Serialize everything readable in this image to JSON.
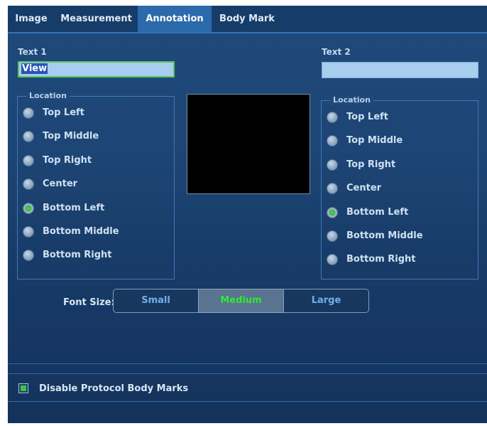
{
  "tabs": [
    "Image",
    "Measurement",
    "Annotation",
    "Body Mark"
  ],
  "active_tab": "Annotation",
  "text1": {
    "label": "Text 1",
    "value": "View"
  },
  "text2": {
    "label": "Text 2",
    "value": ""
  },
  "location_left": {
    "legend": "Location",
    "options": [
      "Top Left",
      "Top Middle",
      "Top Right",
      "Center",
      "Bottom Left",
      "Bottom Middle",
      "Bottom Right"
    ],
    "selected": "Bottom Left"
  },
  "location_right": {
    "legend": "Location",
    "options": [
      "Top Left",
      "Top Middle",
      "Top Right",
      "Center",
      "Bottom Left",
      "Bottom Middle",
      "Bottom Right"
    ],
    "selected": "Bottom Left"
  },
  "font_size": {
    "label": "Font Size:",
    "options": [
      "Small",
      "Medium",
      "Large"
    ],
    "selected": "Medium"
  },
  "disable_protocol": {
    "label": "Disable Protocol Body Marks",
    "checked": true
  },
  "colors": {
    "accent_green": "#2eea35",
    "active_tab": "#2b6aab",
    "text_blue": "#6fb1ea"
  }
}
